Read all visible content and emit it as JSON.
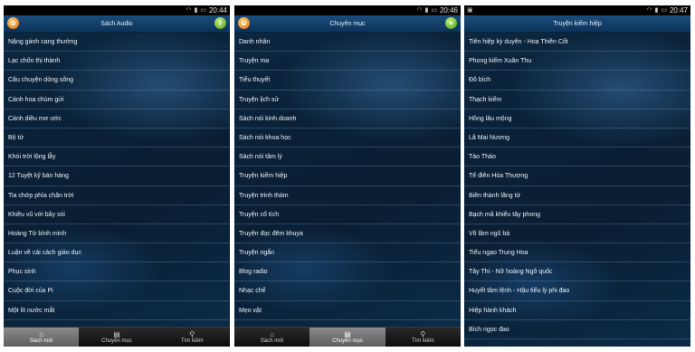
{
  "screens": [
    {
      "status_time": "20:44",
      "title": "Sách Audio",
      "items": [
        "Nặng gánh cang thường",
        "Lạc chốn thị thành",
        "Câu chuyện dòng sông",
        "Cánh hoa chùm gửi",
        "Cánh diều mơ ước",
        "Bộ tứ",
        "Khói trời lộng lẫy",
        "12 Tuyệt kỹ bán hàng",
        "Tia chớp phía chân trời",
        "Khiêu vũ với bầy sói",
        "Hoàng Tử bình minh",
        "Luận về cái cách giáo dục",
        "Phục sinh",
        "Cuộc đời của Pi",
        "Một lít nước mắt"
      ],
      "tabs": [
        {
          "label": "Sách mới",
          "icon": "house-icon",
          "active": true
        },
        {
          "label": "Chuyên mục",
          "icon": "book-icon",
          "active": false
        },
        {
          "label": "Tìm kiếm",
          "icon": "search-icon",
          "active": false
        }
      ]
    },
    {
      "status_time": "20:46",
      "title": "Chuyên mục",
      "items": [
        "Danh nhân",
        "Truyện ma",
        "Tiểu thuyết",
        "Truyện lịch sử",
        "Sách nói kinh doanh",
        "Sách nói khoa học",
        "Sách nói tâm lý",
        "Truyện kiếm hiệp",
        "Truyện trinh thám",
        "Truyện cổ tích",
        "Truyện đọc đêm khuya",
        "Truyện ngắn",
        "Blog radio",
        "Nhạc chế",
        "Mẹo vặt"
      ],
      "tabs": [
        {
          "label": "Sách mới",
          "icon": "house-icon",
          "active": false
        },
        {
          "label": "Chuyên mục",
          "icon": "book-icon",
          "active": true
        },
        {
          "label": "Tìm kiếm",
          "icon": "search-icon",
          "active": false
        }
      ]
    },
    {
      "status_time": "20:47",
      "title": "Truyện kiếm hiệp",
      "items": [
        "Tiên hiệp kỳ duyên - Hoa Thiên Cốt",
        "Phong kiếm Xuân Thu",
        "Đô bích",
        "Thạch kiếm",
        "Hồng lâu mộng",
        "Lã Mai Nương",
        "Tào Tháo",
        "Tế điên Hòa Thượng",
        "Biên thành lãng tử",
        "Bạch mã khiếu tây phong",
        "Võ lâm ngũ bá",
        "Tiếu ngạo Trung Hoa",
        "Tây Thi - Nữ hoàng Ngô quốc",
        "Huyết tâm lệnh - Hậu tiểu lý phi đao",
        "Hiệp hành khách",
        "Bích ngọc đao"
      ]
    }
  ],
  "colors": {
    "title_bar": "#1a4e7e",
    "list_bg": "#0a2238",
    "tab_active": "#7a7a7a"
  }
}
